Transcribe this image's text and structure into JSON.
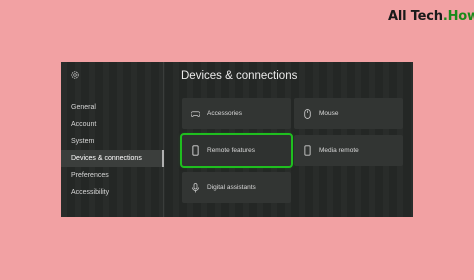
{
  "watermark": {
    "main": "All Tech",
    "accent": ".How"
  },
  "page": {
    "title": "Devices & connections"
  },
  "sidebar": {
    "items": [
      {
        "label": "General"
      },
      {
        "label": "Account"
      },
      {
        "label": "System"
      },
      {
        "label": "Devices & connections",
        "selected": true
      },
      {
        "label": "Preferences"
      },
      {
        "label": "Accessibility"
      }
    ]
  },
  "tiles": [
    {
      "label": "Accessories",
      "icon": "gamepad-icon"
    },
    {
      "label": "Mouse",
      "icon": "mouse-icon"
    },
    {
      "label": "Remote features",
      "icon": "remote-icon",
      "focused": true
    },
    {
      "label": "Media remote",
      "icon": "media-remote-icon"
    },
    {
      "label": "Digital assistants",
      "icon": "assistant-icon"
    }
  ],
  "colors": {
    "focus": "#1fbf1f",
    "window_bg": "#252826",
    "page_bg": "#f2a1a3"
  }
}
